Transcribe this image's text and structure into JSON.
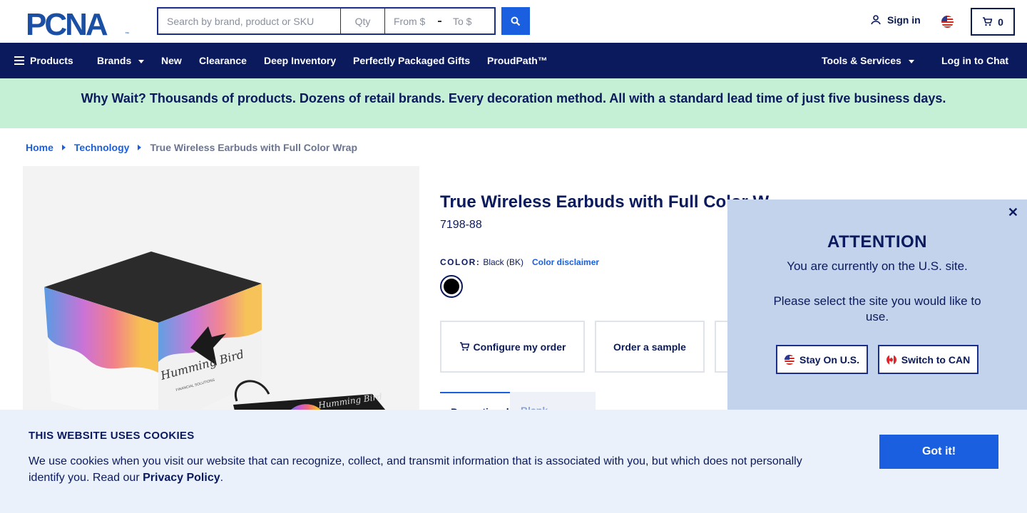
{
  "header": {
    "search": {
      "placeholder": "Search by brand, product or SKU",
      "qty_placeholder": "Qty",
      "from_placeholder": "From $",
      "to_placeholder": "To $"
    },
    "sign_in_label": "Sign in",
    "cart_count": "0"
  },
  "nav": {
    "products": "Products",
    "brands": "Brands",
    "new": "New",
    "clearance": "Clearance",
    "deep_inventory": "Deep Inventory",
    "packaged_gifts": "Perfectly Packaged Gifts",
    "proudpath": "ProudPath™",
    "tools": "Tools & Services",
    "chat": "Log in to Chat"
  },
  "banner": {
    "text": "Why Wait? Thousands of products. Dozens of retail brands. Every decoration method. All with a standard lead time of just five business days."
  },
  "breadcrumb": {
    "home": "Home",
    "category": "Technology",
    "current": "True Wireless Earbuds with Full Color Wrap"
  },
  "product": {
    "title": "True Wireless Earbuds with Full Color W",
    "sku": "7198-88",
    "color_label": "COLOR:",
    "color_value": "Black (BK)",
    "color_disclaimer": "Color disclaimer",
    "swatch_color": "#000000",
    "configure_label": "Configure my order",
    "sample_label": "Order a sample",
    "tabs": [
      "Promotional",
      "Blank Samples"
    ],
    "box_brand": "Humming Bird",
    "box_sub": "FINANCIAL SOLUTIONS"
  },
  "popup": {
    "title": "ATTENTION",
    "line1": "You are currently on the U.S. site.",
    "line2": "Please select the site you would like to use.",
    "stay_label": "Stay On U.S.",
    "switch_label": "Switch to CAN"
  },
  "cookie": {
    "title": "THIS WEBSITE USES COOKIES",
    "text": "We use cookies when you visit our website that can recognize, collect, and transmit information that is associated with you, but which does not personally identify you. Read our ",
    "link": "Privacy Policy",
    "end": ".",
    "button": "Got it!"
  },
  "colors": {
    "navy": "#0a1a5c",
    "accent_blue": "#1a5fe0",
    "banner_green": "#c6f0d6",
    "popup_blue": "#c4d3ec",
    "cookie_bg": "#eaf1fb"
  }
}
